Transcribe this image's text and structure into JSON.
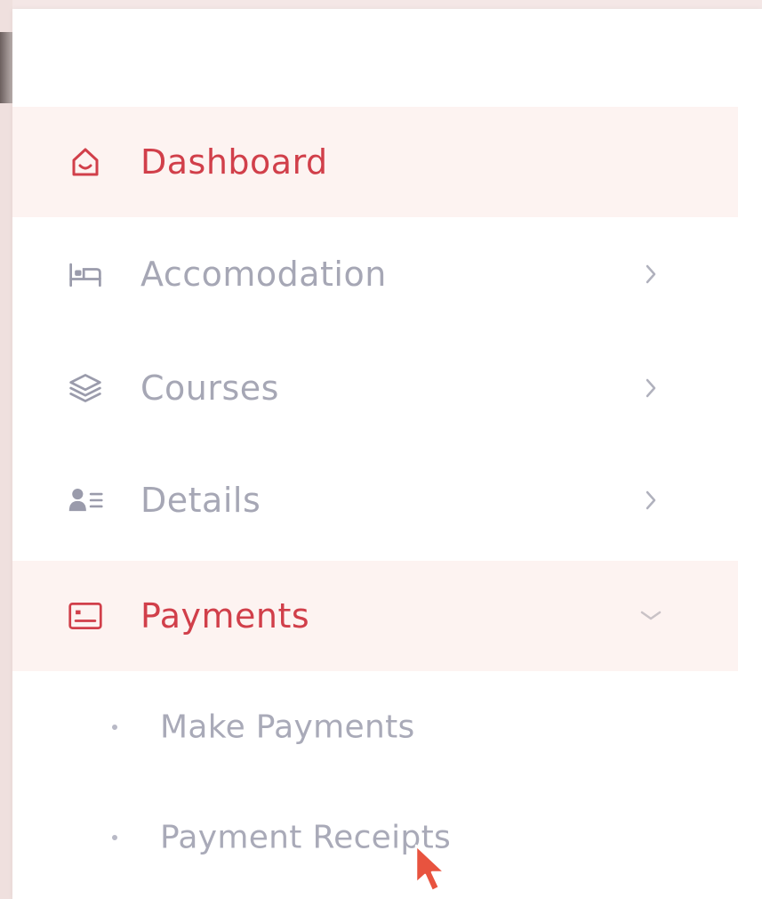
{
  "sidebar": {
    "items": [
      {
        "label": "Dashboard",
        "icon": "home-icon",
        "active": true,
        "has_chevron": false
      },
      {
        "label": "Accomodation",
        "icon": "bed-icon",
        "active": false,
        "has_chevron": true,
        "chevron": "chevron-right-icon"
      },
      {
        "label": "Courses",
        "icon": "layers-icon",
        "active": false,
        "has_chevron": true,
        "chevron": "chevron-right-icon"
      },
      {
        "label": "Details",
        "icon": "user-details-icon",
        "active": false,
        "has_chevron": true,
        "chevron": "chevron-right-icon"
      },
      {
        "label": "Payments",
        "icon": "payments-icon",
        "active": true,
        "expanded": true,
        "chevron": "chevron-down-icon"
      }
    ],
    "payments_submenu": [
      {
        "label": "Make Payments"
      },
      {
        "label": "Payment Receipts"
      }
    ]
  },
  "colors": {
    "accent": "#d13f4a",
    "active_bg": "#fdf3f1",
    "muted_text": "#a6a7b5",
    "muted_icon": "#9a9bab",
    "page_bg": "#f4e7e6"
  }
}
